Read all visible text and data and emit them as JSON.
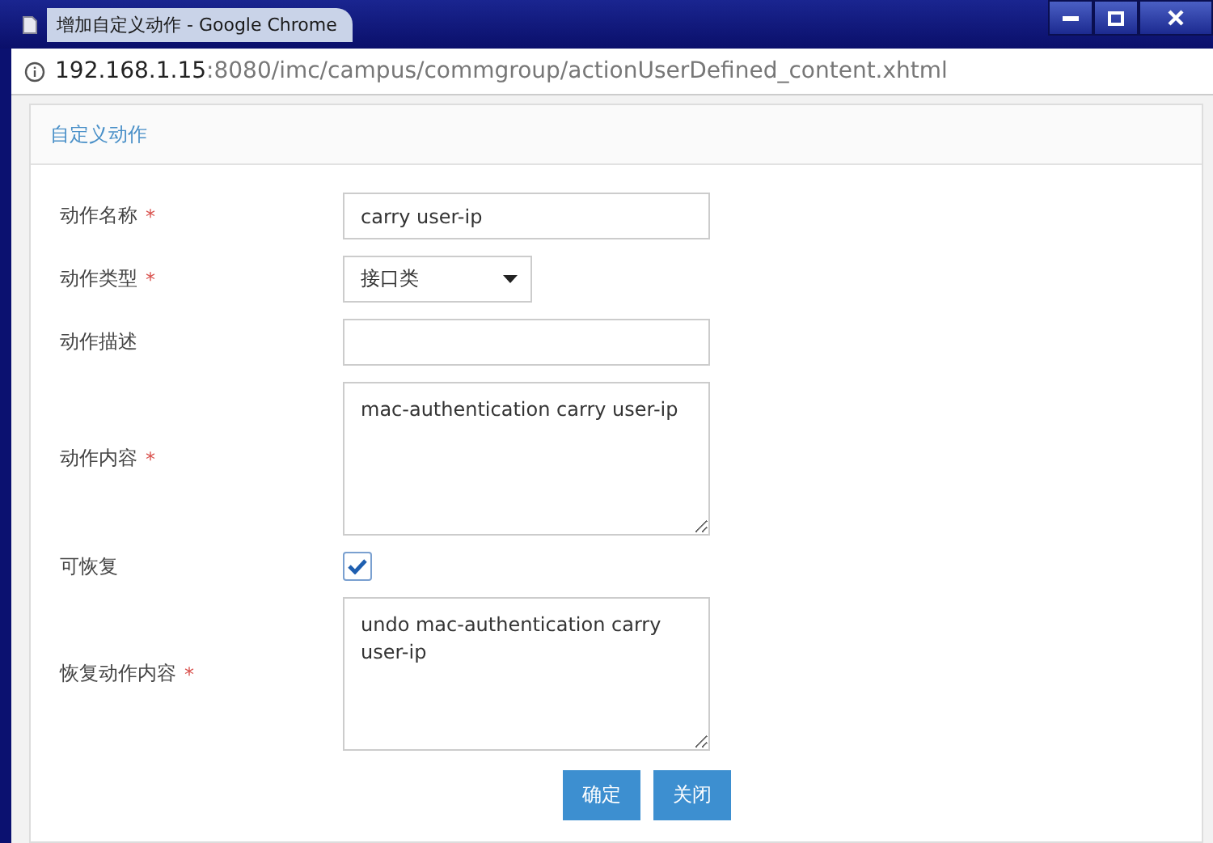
{
  "window": {
    "title": "增加自定义动作 - Google Chrome"
  },
  "address_bar": {
    "host": "192.168.1.15",
    "path": ":8080/imc/campus/commgroup/actionUserDefined_content.xhtml"
  },
  "panel": {
    "title": "自定义动作"
  },
  "fields": [
    {
      "kind": "text",
      "label": "动作名称",
      "required_mark": "*",
      "value": "carry user-ip"
    },
    {
      "kind": "select",
      "label": "动作类型",
      "required_mark": "*",
      "value": "接口类"
    },
    {
      "kind": "text",
      "label": "动作描述"
    },
    {
      "kind": "textarea",
      "label": "动作内容",
      "required_mark": "*",
      "value": "mac-authentication carry user-ip"
    },
    {
      "kind": "checkbox",
      "label": "可恢复",
      "checked": true
    },
    {
      "kind": "textarea",
      "label": "恢复动作内容",
      "required_mark": "*",
      "value": "undo mac-authentication carry user-ip"
    }
  ],
  "buttons": [
    "确定",
    "关闭"
  ]
}
